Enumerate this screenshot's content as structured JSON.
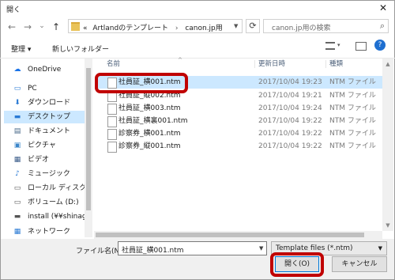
{
  "window": {
    "title": "開く",
    "close_glyph": "✕"
  },
  "nav": {
    "back": "←",
    "forward": "→",
    "dropdown": "⌄",
    "up": "↑"
  },
  "address": {
    "prefix": "«",
    "parts": [
      "Artlandのテンプレート",
      "canon.jp用"
    ],
    "separator": "›"
  },
  "search": {
    "placeholder": "canon.jp用の検索",
    "icon": "search-icon"
  },
  "toolbar": {
    "organize_label": "整理 ▾",
    "new_folder_label": "新しいフォルダー"
  },
  "columns": {
    "name": "名前",
    "date": "更新日時",
    "type": "種類"
  },
  "sidebar": {
    "items": [
      {
        "label": "OneDrive",
        "icon": "cloud-icon"
      },
      {
        "label": "PC",
        "icon": "pc-icon"
      },
      {
        "label": "ダウンロード",
        "icon": "download-icon"
      },
      {
        "label": "デスクトップ",
        "icon": "desktop-icon"
      },
      {
        "label": "ドキュメント",
        "icon": "document-icon"
      },
      {
        "label": "ピクチャ",
        "icon": "picture-icon"
      },
      {
        "label": "ビデオ",
        "icon": "video-icon"
      },
      {
        "label": "ミュージック",
        "icon": "music-icon"
      },
      {
        "label": "ローカル ディスク (C",
        "icon": "disk-icon"
      },
      {
        "label": "ボリューム (D:)",
        "icon": "disk-icon"
      },
      {
        "label": "install (¥¥shinag",
        "icon": "network-drive-icon"
      },
      {
        "label": "ネットワーク",
        "icon": "network-icon"
      }
    ]
  },
  "files": [
    {
      "name": "社員証_横001.ntm",
      "date": "2017/10/04 19:23",
      "type": "NTM ファイル"
    },
    {
      "name": "社員証_縦002.ntm",
      "date": "2017/10/04 19:21",
      "type": "NTM ファイル"
    },
    {
      "name": "社員証_横003.ntm",
      "date": "2017/10/04 19:24",
      "type": "NTM ファイル"
    },
    {
      "name": "社員証_横裏001.ntm",
      "date": "2017/10/04 19:22",
      "type": "NTM ファイル"
    },
    {
      "name": "診察券_横001.ntm",
      "date": "2017/10/04 19:22",
      "type": "NTM ファイル"
    },
    {
      "name": "診察券_縦001.ntm",
      "date": "2017/10/04 19:22",
      "type": "NTM ファイル"
    }
  ],
  "footer": {
    "filename_label": "ファイル名(N):",
    "filename_value": "社員証_横001.ntm",
    "filter_value": "Template files (*.ntm)",
    "open_label": "開く(O)",
    "cancel_label": "キャンセル"
  },
  "colors": {
    "selection": "#cce8ff",
    "highlight": "#c00000",
    "accent": "#0078d7"
  }
}
